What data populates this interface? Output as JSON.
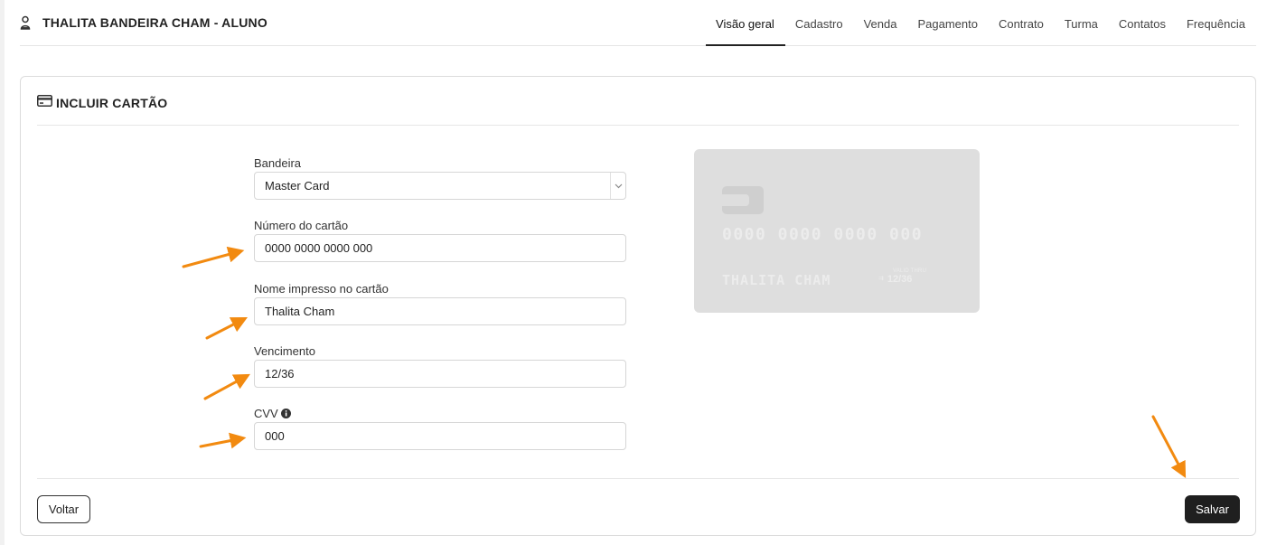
{
  "header": {
    "student_name": "THALITA BANDEIRA CHAM - ALUNO",
    "tabs": [
      {
        "label": "Visão geral",
        "active": true
      },
      {
        "label": "Cadastro"
      },
      {
        "label": "Venda"
      },
      {
        "label": "Pagamento"
      },
      {
        "label": "Contrato"
      },
      {
        "label": "Turma"
      },
      {
        "label": "Contatos"
      },
      {
        "label": "Frequência"
      }
    ]
  },
  "panel": {
    "title": "INCLUIR CARTÃO",
    "icon": "credit-card-icon"
  },
  "form": {
    "bandeira": {
      "label": "Bandeira",
      "value": "Master Card"
    },
    "numero": {
      "label": "Número do cartão",
      "value": "0000 0000 0000 000"
    },
    "nome": {
      "label": "Nome impresso no cartão",
      "value": "Thalita Cham"
    },
    "vencimento": {
      "label": "Vencimento",
      "value": "12/36"
    },
    "cvv": {
      "label": "CVV",
      "value": "000"
    }
  },
  "card_preview": {
    "number": "0000 0000 0000 000",
    "holder": "THALITA CHAM",
    "valid_label": "VALID THRU",
    "expiry": "12/36"
  },
  "actions": {
    "back_label": "Voltar",
    "save_label": "Salvar"
  },
  "annotation_color": "#f28a10"
}
